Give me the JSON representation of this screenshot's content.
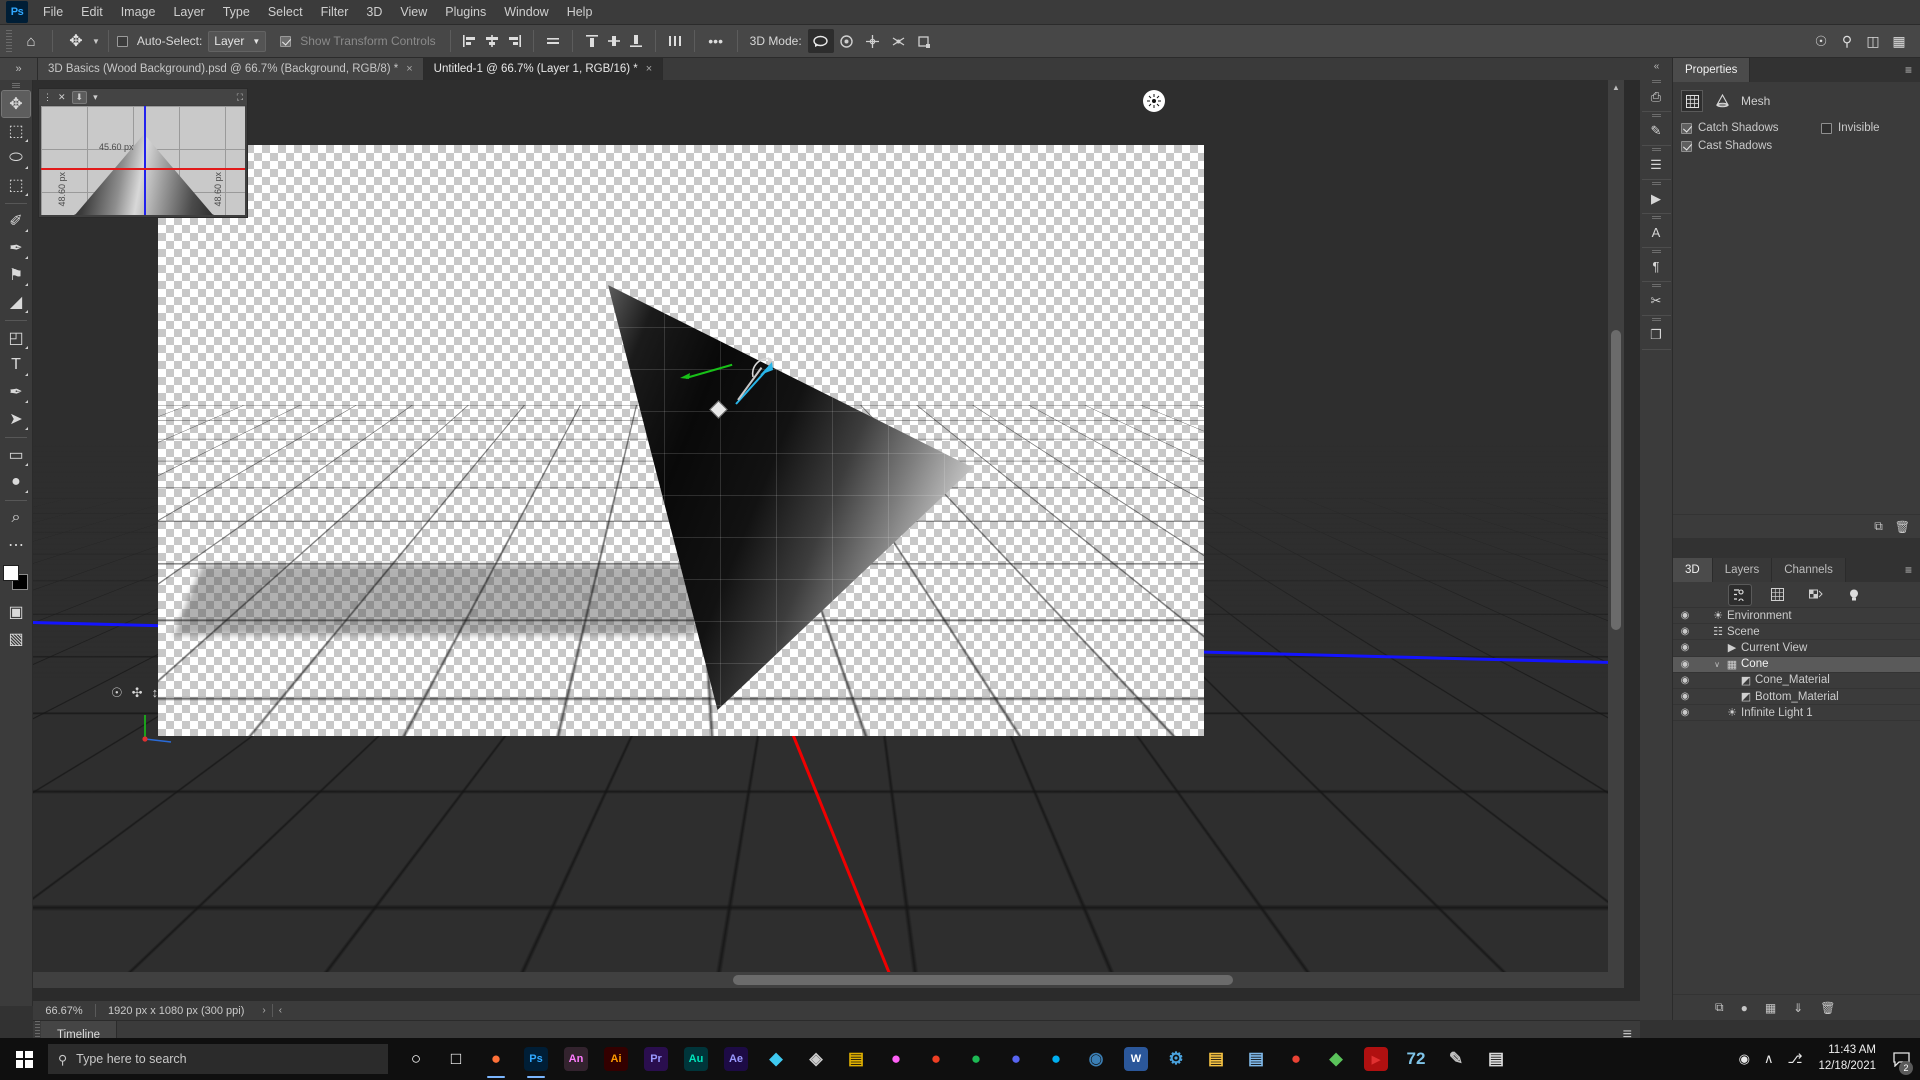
{
  "app": {
    "name": "Adobe Photoshop",
    "logo_text": "Ps"
  },
  "menubar": {
    "items": [
      {
        "label": "File"
      },
      {
        "label": "Edit"
      },
      {
        "label": "Image"
      },
      {
        "label": "Layer"
      },
      {
        "label": "Type"
      },
      {
        "label": "Select"
      },
      {
        "label": "Filter"
      },
      {
        "label": "3D"
      },
      {
        "label": "View"
      },
      {
        "label": "Plugins"
      },
      {
        "label": "Window"
      },
      {
        "label": "Help"
      }
    ]
  },
  "optionsbar": {
    "home_icon": "home-icon",
    "tool_icon": "move-tool-icon",
    "auto_select_label": "Auto-Select:",
    "auto_select_checked": false,
    "layer_select_value": "Layer",
    "show_transform_label": "Show Transform Controls",
    "show_transform_checked": true,
    "show_transform_disabled": true,
    "more_label": "•••",
    "mode3d_label": "3D Mode:",
    "mode3d_buttons": [
      {
        "name": "rotate-3d-icon",
        "active": true
      },
      {
        "name": "roll-3d-icon",
        "active": false
      },
      {
        "name": "pan-3d-icon",
        "active": false
      },
      {
        "name": "slide-3d-icon",
        "active": false
      },
      {
        "name": "scale-3d-icon",
        "active": false
      }
    ],
    "right_icons": [
      {
        "name": "share-icon"
      },
      {
        "name": "search-icon"
      },
      {
        "name": "workspace-icon"
      },
      {
        "name": "arrange-documents-icon"
      }
    ]
  },
  "tabbar": {
    "expander_label": "»",
    "tabs": [
      {
        "label": "3D Basics (Wood Background).psd @ 66.7% (Background, RGB/8) *",
        "active": false,
        "close": "×"
      },
      {
        "label": "Untitled-1 @ 66.7% (Layer 1, RGB/16) *",
        "active": true,
        "close": "×"
      }
    ]
  },
  "toolbar": {
    "tools": [
      {
        "name": "move-tool",
        "glyph": "✥",
        "active": true,
        "has_submenu": false
      },
      {
        "name": "rectangular-marquee-tool",
        "glyph": "⬚",
        "active": false,
        "has_submenu": true
      },
      {
        "name": "lasso-tool",
        "glyph": "⬭",
        "active": false,
        "has_submenu": true
      },
      {
        "name": "object-selection-tool",
        "glyph": "⬚",
        "active": false,
        "has_submenu": true
      },
      {
        "name": "eyedropper-tool",
        "glyph": "✐",
        "active": false,
        "has_submenu": true
      },
      {
        "name": "brush-tool",
        "glyph": "✒",
        "active": false,
        "has_submenu": true
      },
      {
        "name": "clone-stamp-tool",
        "glyph": "⚑",
        "active": false,
        "has_submenu": true
      },
      {
        "name": "eraser-tool",
        "glyph": "◢",
        "active": false,
        "has_submenu": true
      },
      {
        "name": "gradient-tool",
        "glyph": "◰",
        "active": false,
        "has_submenu": true
      },
      {
        "name": "type-tool",
        "glyph": "T",
        "active": false,
        "has_submenu": true
      },
      {
        "name": "pen-tool",
        "glyph": "✒",
        "active": false,
        "has_submenu": true
      },
      {
        "name": "path-selection-tool",
        "glyph": "➤",
        "active": false,
        "has_submenu": true
      },
      {
        "name": "rectangle-tool",
        "glyph": "▭",
        "active": false,
        "has_submenu": true
      },
      {
        "name": "dodge-tool",
        "glyph": "●",
        "active": false,
        "has_submenu": true
      },
      {
        "name": "zoom-tool",
        "glyph": "⌕",
        "active": false,
        "has_submenu": false
      },
      {
        "name": "edit-toolbar",
        "glyph": "⋯",
        "active": false,
        "has_submenu": false
      }
    ],
    "foreground_color": "#ffffff",
    "background_color": "#000000",
    "bottom_tools": [
      {
        "name": "quick-mask-tool",
        "glyph": "▣"
      },
      {
        "name": "screen-mode-tool",
        "glyph": "▧"
      }
    ]
  },
  "preview": {
    "title_icons": [
      "menu-icon",
      "close-icon",
      "commit-icon",
      "chevron-down-icon"
    ],
    "resize_icon": "resize-icon",
    "label_top": "45.60 px",
    "label_left": "48.60 px",
    "label_right": "48.60 px"
  },
  "canvas": {
    "orbit_icons": [
      "orbit-3d-icon",
      "pan-3d-icon",
      "zoom-3d-icon"
    ],
    "axis_colors": {
      "x": "#f00000",
      "y": "#00b400",
      "z": "#1414ff"
    },
    "cursor_icon": "3d-rotate-cursor"
  },
  "statusbar": {
    "zoom": "66.67%",
    "dimensions": "1920 px x 1080 px (300 ppi)",
    "next_arrow": "›",
    "prev_arrow": "‹"
  },
  "timeline": {
    "tab_label": "Timeline",
    "menu_icon": "panel-menu-icon"
  },
  "rail": {
    "collapse_icon": "«",
    "items": [
      {
        "name": "libraries-panel-icon",
        "glyph": "⎙"
      },
      {
        "name": "adjustments-panel-icon",
        "glyph": "✎"
      },
      {
        "name": "properties-panel-icon",
        "glyph": "☰"
      },
      {
        "name": "actions-panel-icon",
        "glyph": "▶"
      },
      {
        "name": "character-panel-icon",
        "glyph": "A"
      },
      {
        "name": "paragraph-panel-icon",
        "glyph": "¶"
      },
      {
        "name": "history-panel-icon",
        "glyph": "✂"
      },
      {
        "name": "layer-comps-panel-icon",
        "glyph": "❐"
      }
    ]
  },
  "properties": {
    "tab_label": "Properties",
    "menu_icon": "panel-menu-icon",
    "section_icon_left": "mesh-grid-icon",
    "section_icon_right": "mesh-shape-icon",
    "section_title": "Mesh",
    "options": [
      {
        "label": "Catch Shadows",
        "checked": true,
        "name": "catch-shadows-checkbox"
      },
      {
        "label": "Cast Shadows",
        "checked": true,
        "name": "cast-shadows-checkbox"
      },
      {
        "label": "Invisible",
        "checked": false,
        "name": "invisible-checkbox"
      }
    ],
    "footer_icons": [
      {
        "name": "new-3d-object-icon",
        "glyph": "⧉"
      },
      {
        "name": "delete-icon",
        "glyph": "🗑"
      }
    ]
  },
  "panel3d": {
    "tabs": [
      {
        "label": "3D",
        "active": true
      },
      {
        "label": "Layers",
        "active": false
      },
      {
        "label": "Channels",
        "active": false
      }
    ],
    "menu_icon": "panel-menu-icon",
    "filter_tools": [
      {
        "name": "filter-scene-icon",
        "glyph": "☰",
        "active": true
      },
      {
        "name": "filter-mesh-icon",
        "glyph": "▦",
        "active": false
      },
      {
        "name": "filter-material-icon",
        "glyph": "◐",
        "active": false
      },
      {
        "name": "filter-light-icon",
        "glyph": "●",
        "active": false
      }
    ],
    "tree": [
      {
        "label": "Environment",
        "icon": "environment-icon",
        "indent": 0,
        "visible": true,
        "selected": false,
        "expander": ""
      },
      {
        "label": "Scene",
        "icon": "scene-icon",
        "indent": 0,
        "visible": true,
        "selected": false,
        "expander": ""
      },
      {
        "label": "Current View",
        "icon": "camera-icon",
        "indent": 1,
        "visible": true,
        "selected": false,
        "expander": ""
      },
      {
        "label": "Cone",
        "icon": "mesh-icon",
        "indent": 1,
        "visible": true,
        "selected": true,
        "expander": "∨"
      },
      {
        "label": "Cone_Material",
        "icon": "material-icon",
        "indent": 2,
        "visible": true,
        "selected": false,
        "expander": ""
      },
      {
        "label": "Bottom_Material",
        "icon": "material-icon",
        "indent": 2,
        "visible": true,
        "selected": false,
        "expander": ""
      },
      {
        "label": "Infinite Light 1",
        "icon": "light-icon",
        "indent": 1,
        "visible": true,
        "selected": false,
        "expander": ""
      }
    ],
    "footer_icons": [
      {
        "name": "add-mesh-icon",
        "glyph": "⧉"
      },
      {
        "name": "add-light-icon",
        "glyph": "●"
      },
      {
        "name": "render-icon",
        "glyph": "▦"
      },
      {
        "name": "ground-icon",
        "glyph": "⤓"
      },
      {
        "name": "delete-3d-icon",
        "glyph": "🗑"
      }
    ]
  },
  "taskbar": {
    "start_icon": "windows-start-icon",
    "search_placeholder": "Type here to search",
    "search_icon": "search-icon",
    "items": [
      {
        "name": "cortana-icon",
        "glyph": "○",
        "color": "#ffffff",
        "bg": "transparent",
        "running": false
      },
      {
        "name": "task-view-icon",
        "glyph": "□",
        "color": "#ffffff",
        "bg": "transparent",
        "running": false
      },
      {
        "name": "firefox-icon",
        "glyph": "●",
        "color": "#ff7139",
        "bg": "transparent",
        "running": true
      },
      {
        "name": "photoshop-icon",
        "glyph": "Ps",
        "color": "#31a8ff",
        "bg": "#001e36",
        "running": true
      },
      {
        "name": "animate-icon",
        "glyph": "An",
        "color": "#ff7bff",
        "bg": "#33232e",
        "running": false
      },
      {
        "name": "illustrator-icon",
        "glyph": "Ai",
        "color": "#ff9a00",
        "bg": "#330000",
        "running": false
      },
      {
        "name": "premiere-icon",
        "glyph": "Pr",
        "color": "#9999ff",
        "bg": "#2a0e4e",
        "running": false
      },
      {
        "name": "audition-icon",
        "glyph": "Au",
        "color": "#00e4bb",
        "bg": "#00353a",
        "running": false
      },
      {
        "name": "after-effects-icon",
        "glyph": "Ae",
        "color": "#9999ff",
        "bg": "#1d0b45",
        "running": false
      },
      {
        "name": "lightroom-icon",
        "glyph": "◆",
        "color": "#3fc9f0",
        "bg": "transparent",
        "running": false
      },
      {
        "name": "dimension-icon",
        "glyph": "◈",
        "color": "#cccccc",
        "bg": "transparent",
        "running": false
      },
      {
        "name": "bridge-icon",
        "glyph": "▤",
        "color": "#e0b000",
        "bg": "transparent",
        "running": false
      },
      {
        "name": "xd-icon",
        "glyph": "●",
        "color": "#ff61f6",
        "bg": "transparent",
        "running": false
      },
      {
        "name": "acrobat-icon",
        "glyph": "●",
        "color": "#ee3f24",
        "bg": "transparent",
        "running": false
      },
      {
        "name": "spotify-icon",
        "glyph": "●",
        "color": "#1db954",
        "bg": "transparent",
        "running": false
      },
      {
        "name": "discord-icon",
        "glyph": "●",
        "color": "#5865f2",
        "bg": "transparent",
        "running": false
      },
      {
        "name": "skype-icon",
        "glyph": "●",
        "color": "#00aff0",
        "bg": "transparent",
        "running": false
      },
      {
        "name": "obs-icon",
        "glyph": "◉",
        "color": "#3b7fb5",
        "bg": "transparent",
        "running": false
      },
      {
        "name": "word-icon",
        "glyph": "W",
        "color": "#ffffff",
        "bg": "#2b579a",
        "running": false
      },
      {
        "name": "tool-icon",
        "glyph": "⚙",
        "color": "#4aa3df",
        "bg": "transparent",
        "running": false
      },
      {
        "name": "explorer-icon",
        "glyph": "▤",
        "color": "#f5c242",
        "bg": "transparent",
        "running": false
      },
      {
        "name": "folder-icon",
        "glyph": "▤",
        "color": "#7fb8e8",
        "bg": "transparent",
        "running": false
      },
      {
        "name": "chrome-icon",
        "glyph": "●",
        "color": "#ea4335",
        "bg": "transparent",
        "running": false
      },
      {
        "name": "store-icon",
        "glyph": "◆",
        "color": "#5ac35a",
        "bg": "transparent",
        "running": false
      },
      {
        "name": "media-icon",
        "glyph": "▶",
        "color": "#e03030",
        "bg": "#b01010",
        "running": false
      },
      {
        "name": "calc-icon",
        "glyph": "72",
        "color": "#7fc4e8",
        "bg": "transparent",
        "running": false
      },
      {
        "name": "editor-icon",
        "glyph": "✎",
        "color": "#c0c0c0",
        "bg": "transparent",
        "running": false
      },
      {
        "name": "notes-icon",
        "glyph": "▤",
        "color": "#dcdcdc",
        "bg": "transparent",
        "running": false
      }
    ],
    "tray": [
      {
        "name": "overlay-icon",
        "glyph": "◉"
      },
      {
        "name": "show-hidden-icons",
        "glyph": "∧"
      },
      {
        "name": "network-icon",
        "glyph": "⎇"
      }
    ],
    "clock_time": "11:43 AM",
    "clock_date": "12/18/2021",
    "notification_icon": "notification-icon",
    "notification_count": "2"
  }
}
